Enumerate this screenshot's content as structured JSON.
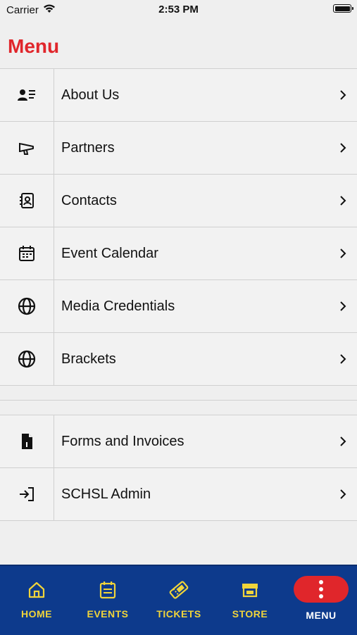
{
  "status_bar": {
    "carrier": "Carrier",
    "time": "2:53 PM"
  },
  "page": {
    "title": "Menu"
  },
  "menu": {
    "group1": [
      {
        "label": "About Us",
        "icon": "contact-card-icon"
      },
      {
        "label": "Partners",
        "icon": "megaphone-icon"
      },
      {
        "label": "Contacts",
        "icon": "address-book-icon"
      },
      {
        "label": "Event Calendar",
        "icon": "calendar-icon"
      },
      {
        "label": "Media Credentials",
        "icon": "globe-icon"
      },
      {
        "label": "Brackets",
        "icon": "globe-icon"
      }
    ],
    "group2": [
      {
        "label": "Forms and Invoices",
        "icon": "file-icon"
      },
      {
        "label": "SCHSL Admin",
        "icon": "sign-in-icon"
      }
    ]
  },
  "tabs": [
    {
      "label": "HOME",
      "icon": "home-icon"
    },
    {
      "label": "EVENTS",
      "icon": "events-icon"
    },
    {
      "label": "TICKETS",
      "icon": "ticket-icon"
    },
    {
      "label": "STORE",
      "icon": "store-icon"
    },
    {
      "label": "MENU",
      "icon": "more-icon"
    }
  ],
  "colors": {
    "accent": "#e0262b",
    "tabbar": "#0d3a8c",
    "tab_label": "#f0d43a"
  }
}
